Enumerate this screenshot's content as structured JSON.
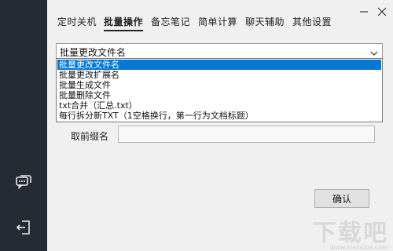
{
  "tabs": [
    {
      "label": "定时关机",
      "active": false
    },
    {
      "label": "批量操作",
      "active": true
    },
    {
      "label": "备忘笔记",
      "active": false
    },
    {
      "label": "简单计算",
      "active": false
    },
    {
      "label": "聊天辅助",
      "active": false
    },
    {
      "label": "其他设置",
      "active": false
    }
  ],
  "window": {
    "minimize_icon": "minimize-icon",
    "close_icon": "close-icon"
  },
  "sidebar": {
    "icons": [
      "chat-icon",
      "logout-icon"
    ]
  },
  "operation_select": {
    "selected": "批量更改文件名",
    "options": [
      "批量更改文件名",
      "批量更改扩展名",
      "批量生成文件",
      "批量删除文件",
      "txt合并（汇总.txt）",
      "每行拆分新TXT（1空格换行，第一行为文档标题）"
    ]
  },
  "prefix_field": {
    "label": "取前缀名",
    "value": ""
  },
  "confirm_button": {
    "label": "确认"
  },
  "watermark": {
    "text": "下载吧",
    "url": "www.xiazaiba.com"
  },
  "colors": {
    "sidebar": "#262b33",
    "selection": "#0078d7",
    "background": "#f0f0f0"
  }
}
